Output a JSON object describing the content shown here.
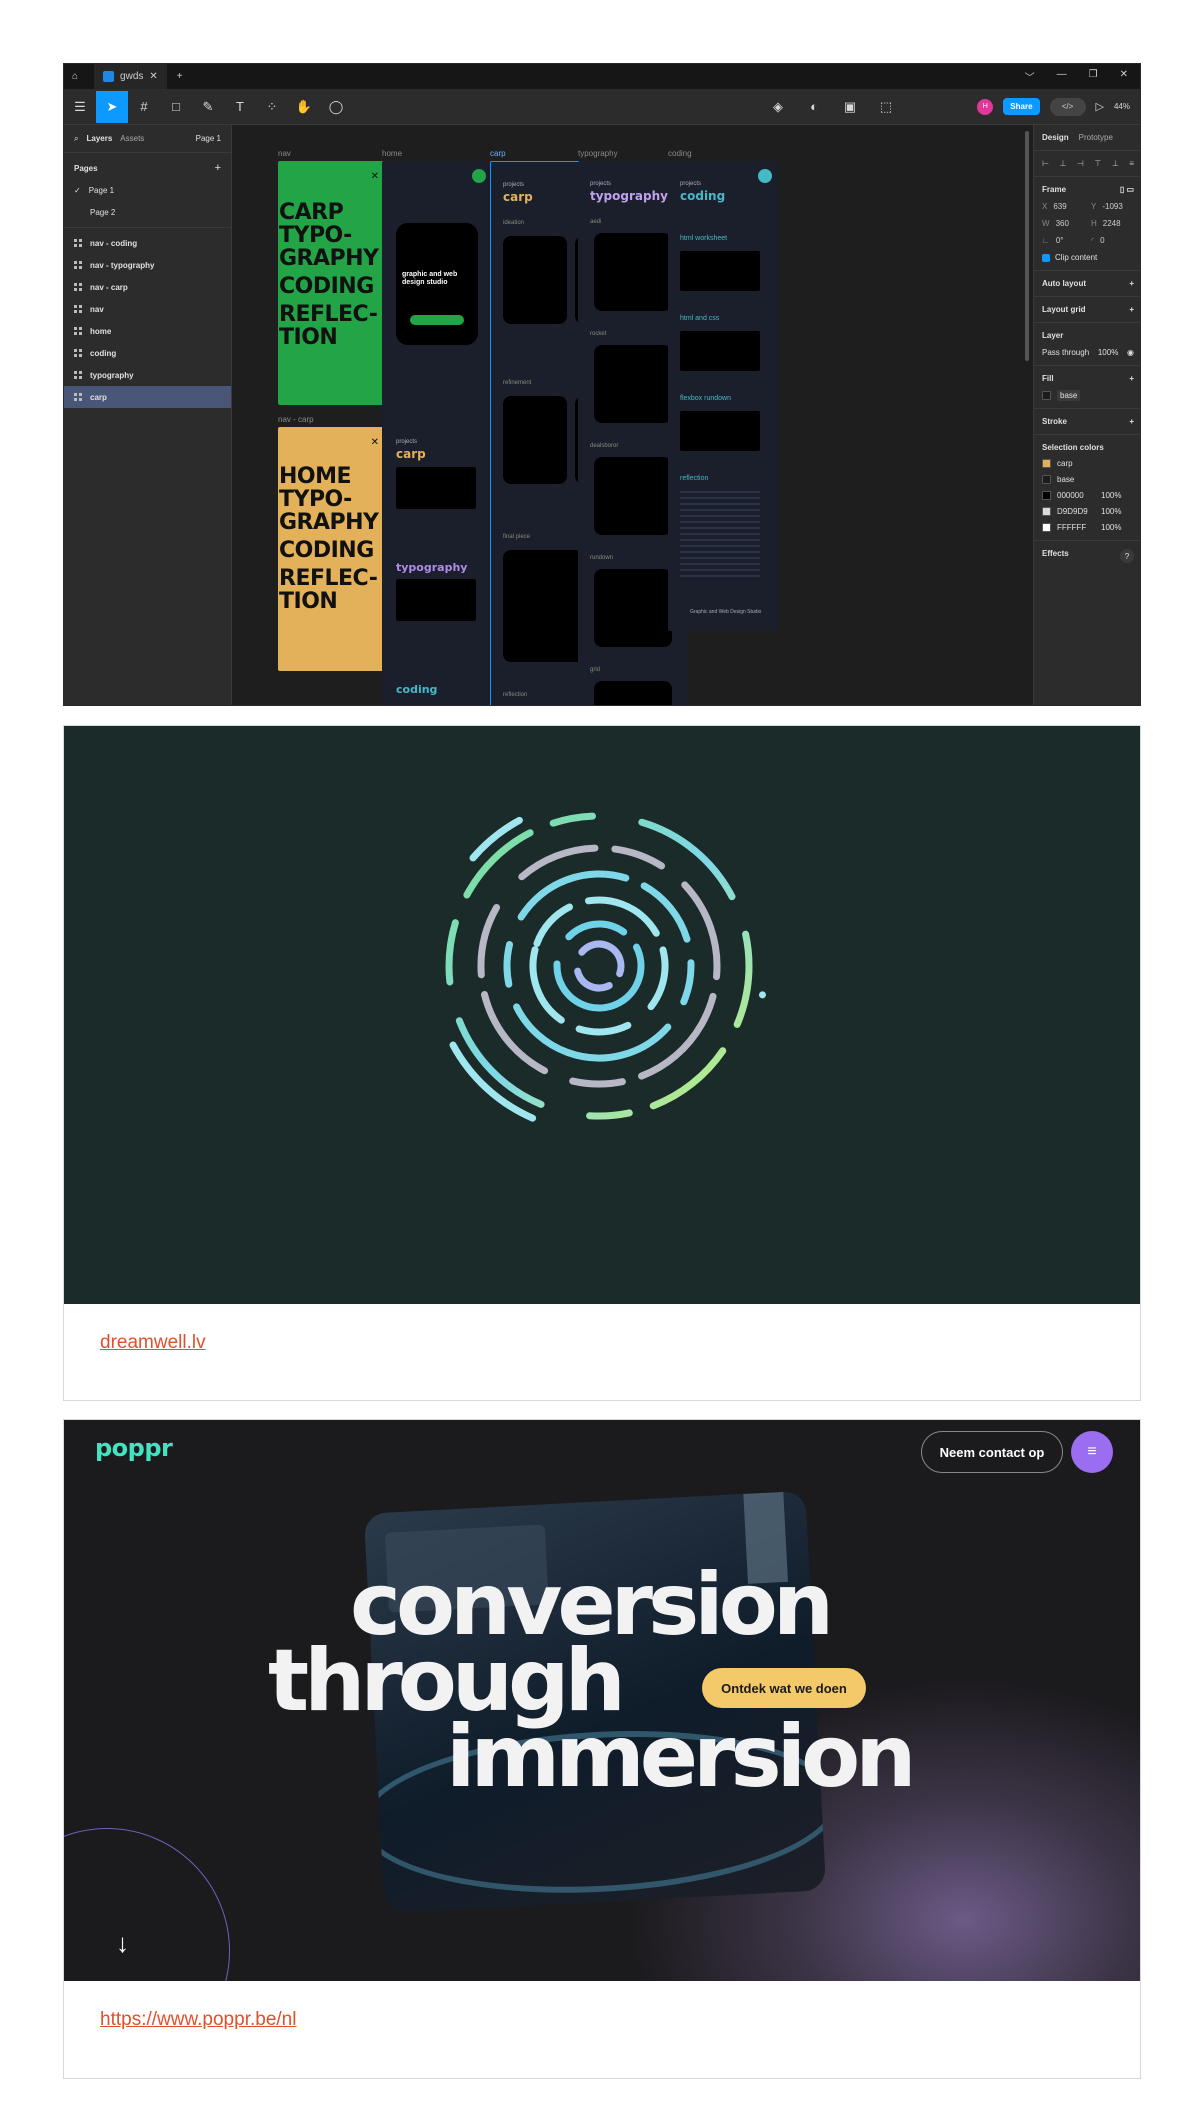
{
  "figma": {
    "tab_title": "gwds",
    "titlebar_controls": [
      "﹀",
      "—",
      "❐",
      "✕"
    ],
    "left_tabs": [
      "Layers",
      "Assets"
    ],
    "page_selector": "Page 1",
    "pages_heading": "Pages",
    "pages": [
      "Page 1",
      "Page 2"
    ],
    "layers": [
      "nav - coding",
      "nav - typography",
      "nav - carp",
      "nav",
      "home",
      "coding",
      "typography",
      "carp"
    ],
    "share_label": "Share",
    "avatar_initial": "H",
    "zoom": "44%",
    "right_tabs": [
      "Design",
      "Prototype"
    ],
    "frame_section": "Frame",
    "x_label": "X",
    "x_value": "639",
    "y_label": "Y",
    "y_value": "-1093",
    "w_label": "W",
    "w_value": "360",
    "h_label": "H",
    "h_value": "2248",
    "rotation_value": "0°",
    "radius_value": "0",
    "clip_content": "Clip content",
    "auto_layout": "Auto layout",
    "layout_grid": "Layout grid",
    "layer_section": "Layer",
    "blend_mode": "Pass through",
    "layer_opacity": "100%",
    "fill_section": "Fill",
    "fill_name": "base",
    "stroke_section": "Stroke",
    "selection_colors_title": "Selection colors",
    "selection_colors": [
      {
        "name": "carp",
        "color": "#e2b15a"
      },
      {
        "name": "base",
        "color": "#1c1c1c"
      },
      {
        "name": "000000",
        "opacity": "100%",
        "color": "#000000"
      },
      {
        "name": "D9D9D9",
        "opacity": "100%",
        "color": "#d9d9d9"
      },
      {
        "name": "FFFFFF",
        "opacity": "100%",
        "color": "#ffffff"
      }
    ],
    "effects": "Effects",
    "help": "?",
    "canvas": {
      "frame_labels": [
        "nav",
        "home",
        "carp",
        "typography",
        "coding",
        "nav - carp"
      ],
      "nav_green_words": [
        "CARP",
        "TYPO-",
        "GRAPHY",
        "CODING",
        "REFLEC-",
        "TION"
      ],
      "nav_yellow_words": [
        "HOME",
        "TYPO-",
        "GRAPHY",
        "CODING",
        "REFLEC-",
        "TION"
      ],
      "close_glyph": "✕",
      "home_phone_text": "graphic and web design studio",
      "home_sections": [
        "carp",
        "typography",
        "coding"
      ],
      "carp_title": "carp",
      "carp_sections": [
        "ideation",
        "refinement",
        "final piece",
        "reflection"
      ],
      "typo_title": "typography",
      "typo_sections": [
        "aedi",
        "rocket",
        "dealsboror",
        "rundown",
        "grid"
      ],
      "coding_title": "coding",
      "coding_sections": [
        "html worksheet",
        "html and css",
        "flexbox rundown",
        "reflection"
      ],
      "footer_text": "Graphic and Web Design Studio",
      "projects_tag": "projects"
    }
  },
  "dreamwell": {
    "link": "dreamwell.lv"
  },
  "poppr": {
    "logo": "poppr",
    "contact_button": "Neem contact op",
    "menu_icon": "≡",
    "headline": [
      "conversion",
      "through",
      "immersion"
    ],
    "cta_button": "Ontdek wat we doen",
    "scroll_arrow": "↓",
    "link": "https://www.poppr.be/nl"
  }
}
